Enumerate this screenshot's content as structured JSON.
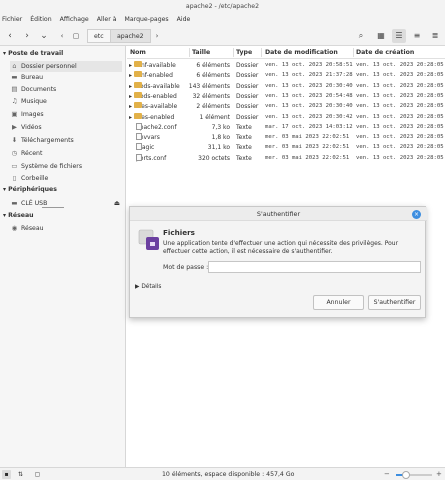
{
  "window": {
    "title": "apache2 - /etc/apache2"
  },
  "menu": [
    "Fichier",
    "Édition",
    "Affichage",
    "Aller à",
    "Marque-pages",
    "Aide"
  ],
  "breadcrumbs": [
    "etc",
    "apache2"
  ],
  "sidebar": {
    "sections": [
      {
        "header": "Poste de travail",
        "items": [
          {
            "label": "Dossier personnel",
            "icon": "home-icon"
          },
          {
            "label": "Bureau",
            "icon": "desktop-icon"
          },
          {
            "label": "Documents",
            "icon": "documents-icon"
          },
          {
            "label": "Musique",
            "icon": "music-icon"
          },
          {
            "label": "Images",
            "icon": "images-icon"
          },
          {
            "label": "Vidéos",
            "icon": "videos-icon"
          },
          {
            "label": "Téléchargements",
            "icon": "download-icon"
          },
          {
            "label": "Récent",
            "icon": "recent-icon"
          },
          {
            "label": "Système de fichiers",
            "icon": "drive-icon"
          },
          {
            "label": "Corbeille",
            "icon": "trash-icon"
          }
        ]
      },
      {
        "header": "Périphériques",
        "items": [
          {
            "label": "CLÉ USB",
            "icon": "usb-icon"
          }
        ]
      },
      {
        "header": "Réseau",
        "items": [
          {
            "label": "Réseau",
            "icon": "network-icon"
          }
        ]
      }
    ]
  },
  "columns": {
    "name": "Nom",
    "size": "Taille",
    "type": "Type",
    "modified": "Date de modification",
    "created": "Date de création"
  },
  "files": [
    {
      "name": "conf-available",
      "size": "6 éléments",
      "type": "Dossier",
      "modified": "ven. 13 oct. 2023 20:58:51",
      "created": "ven. 13 oct. 2023 20:28:05",
      "folder": true
    },
    {
      "name": "conf-enabled",
      "size": "6 éléments",
      "type": "Dossier",
      "modified": "ven. 13 oct. 2023 21:37:28",
      "created": "ven. 13 oct. 2023 20:28:05",
      "folder": true
    },
    {
      "name": "mods-available",
      "size": "143 éléments",
      "type": "Dossier",
      "modified": "ven. 13 oct. 2023 20:30:40",
      "created": "ven. 13 oct. 2023 20:28:05",
      "folder": true
    },
    {
      "name": "mods-enabled",
      "size": "32 éléments",
      "type": "Dossier",
      "modified": "ven. 13 oct. 2023 20:54:48",
      "created": "ven. 13 oct. 2023 20:28:05",
      "folder": true
    },
    {
      "name": "sites-available",
      "size": "2 éléments",
      "type": "Dossier",
      "modified": "ven. 13 oct. 2023 20:30:40",
      "created": "ven. 13 oct. 2023 20:28:05",
      "folder": true
    },
    {
      "name": "sites-enabled",
      "size": "1 élément",
      "type": "Dossier",
      "modified": "ven. 13 oct. 2023 20:30:42",
      "created": "ven. 13 oct. 2023 20:28:05",
      "folder": true
    },
    {
      "name": "apache2.conf",
      "size": "7,3 ko",
      "type": "Texte",
      "modified": "mar. 17 oct. 2023 14:03:12",
      "created": "ven. 13 oct. 2023 20:28:05",
      "folder": false
    },
    {
      "name": "envvars",
      "size": "1,8 ko",
      "type": "Texte",
      "modified": "mer. 03 mai 2023 22:02:51",
      "created": "ven. 13 oct. 2023 20:28:05",
      "folder": false
    },
    {
      "name": "magic",
      "size": "31,1 ko",
      "type": "Texte",
      "modified": "mer. 03 mai 2023 22:02:51",
      "created": "ven. 13 oct. 2023 20:28:05",
      "folder": false
    },
    {
      "name": "ports.conf",
      "size": "320 octets",
      "type": "Texte",
      "modified": "mer. 03 mai 2023 22:02:51",
      "created": "ven. 13 oct. 2023 20:28:05",
      "folder": false
    }
  ],
  "dialog": {
    "title": "S'authentifier",
    "app_name": "Fichiers",
    "message": "Une application tente d'effectuer une action qui nécessite des privilèges. Pour effectuer cette action, il est nécessaire de s'authentifier.",
    "password_label": "Mot de passe :",
    "password_value": "",
    "details_label": "Détails",
    "cancel_label": "Annuler",
    "auth_label": "S'authentifier"
  },
  "status": {
    "text": "10 éléments, espace disponible : 457,4 Go"
  },
  "colors": {
    "accent": "#3d8ee0",
    "folder": "#e2b149",
    "app_icon": "#6b3fa0"
  }
}
